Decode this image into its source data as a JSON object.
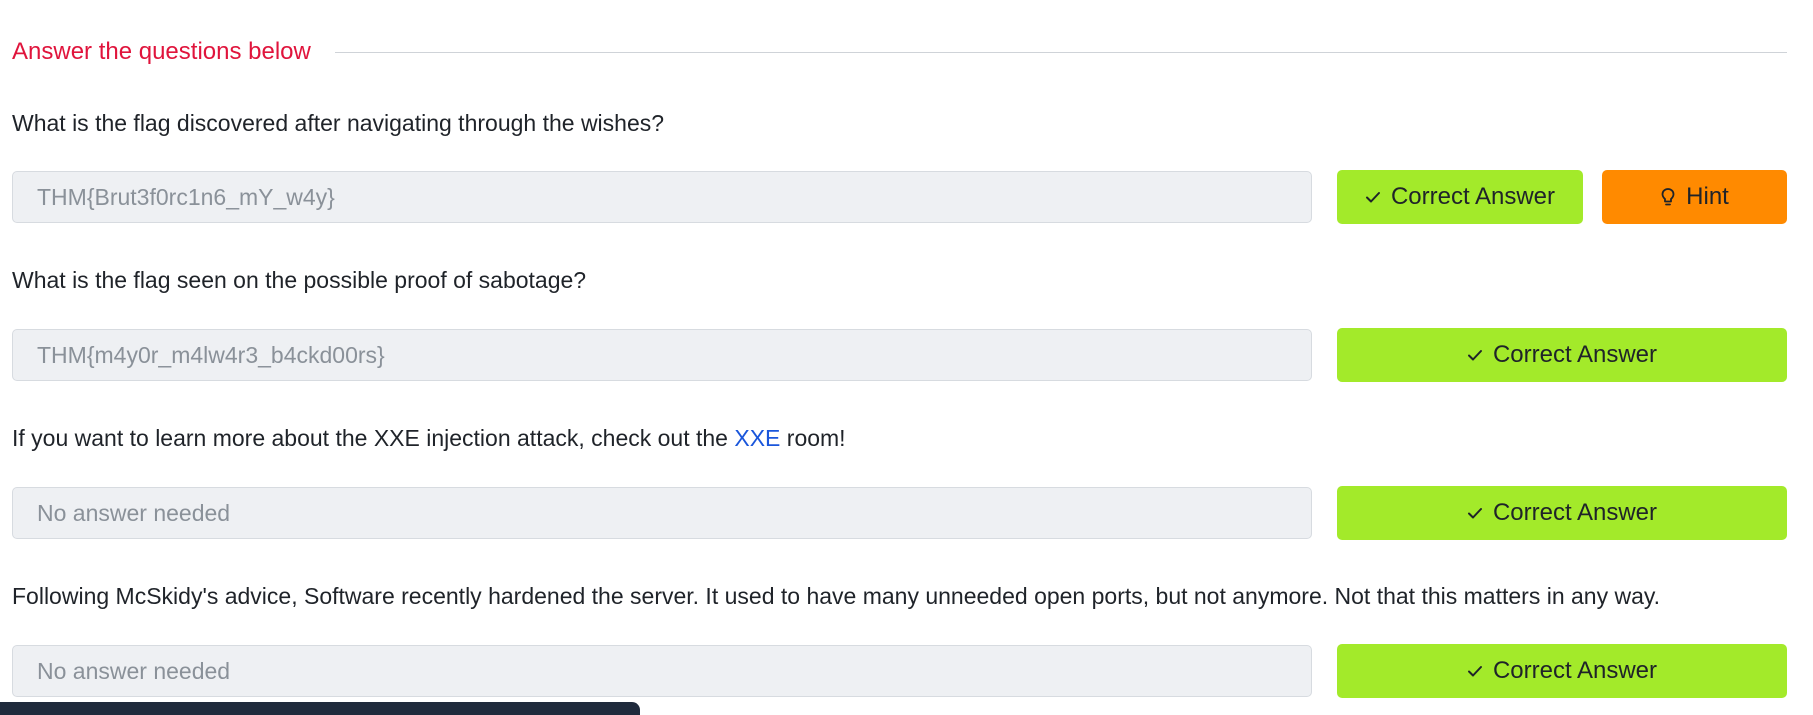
{
  "section": {
    "title": "Answer the questions below"
  },
  "questions": [
    {
      "text": "What is the flag discovered after navigating through the wishes?",
      "answer": "THM{Brut3f0rc1n6_mY_w4y}",
      "button_label": "Correct Answer",
      "hint_label": "Hint"
    },
    {
      "text": "What is the flag seen on the possible proof of sabotage?",
      "answer": "THM{m4y0r_m4lw4r3_b4ckd00rs}",
      "button_label": "Correct Answer"
    },
    {
      "text_before_link": "If you want to learn more about the XXE injection attack, check out the ",
      "link_text": "XXE",
      "text_after_link": " room!",
      "answer": "No answer needed",
      "button_label": "Correct Answer"
    },
    {
      "text": "Following McSkidy's advice, Software recently hardened the server. It used to have many unneeded open ports, but not anymore. Not that this matters in any way.",
      "answer": "No answer needed",
      "button_label": "Correct Answer"
    }
  ],
  "colors": {
    "section_title": "#e0143c",
    "correct_button": "#a3ea2a",
    "hint_button": "#ff8a00",
    "link": "#1a56db"
  },
  "icons": {
    "correct": "check-icon",
    "hint": "lightbulb-icon"
  }
}
